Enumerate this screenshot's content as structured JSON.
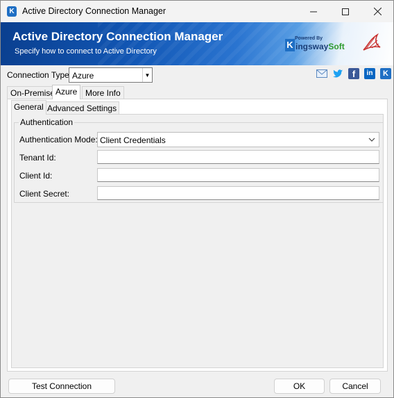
{
  "window": {
    "title": "Active Directory Connection Manager",
    "icon": "kingsway-k-icon"
  },
  "banner": {
    "title": "Active Directory Connection Manager",
    "subtitle": "Specify how to connect to Active Directory",
    "powered_by": "Powered By",
    "brand_k": "K",
    "brand_mid": "ingsway",
    "brand_soft": "Soft"
  },
  "connection": {
    "label": "Connection Type:",
    "value": "Azure"
  },
  "social": {
    "fb": "f",
    "li": "in",
    "k": "K"
  },
  "tabs": [
    {
      "label": "On-Premise"
    },
    {
      "label": "Azure"
    },
    {
      "label": "More Info"
    }
  ],
  "inner_tabs": [
    {
      "label": "General"
    },
    {
      "label": "Advanced Settings"
    }
  ],
  "auth": {
    "legend": "Authentication",
    "mode_label": "Authentication Mode:",
    "mode_value": "Client Credentials",
    "tenant_label": "Tenant Id:",
    "tenant_value": "",
    "client_id_label": "Client Id:",
    "client_id_value": "",
    "secret_label": "Client Secret:",
    "secret_value": ""
  },
  "buttons": {
    "test": "Test Connection",
    "ok": "OK",
    "cancel": "Cancel"
  },
  "colors": {
    "banner_dark": "#0a3f8f",
    "banner_mid": "#2a74d0",
    "kingsway_blue": "#1f6fc4",
    "kingsway_green": "#2e9b2e"
  }
}
